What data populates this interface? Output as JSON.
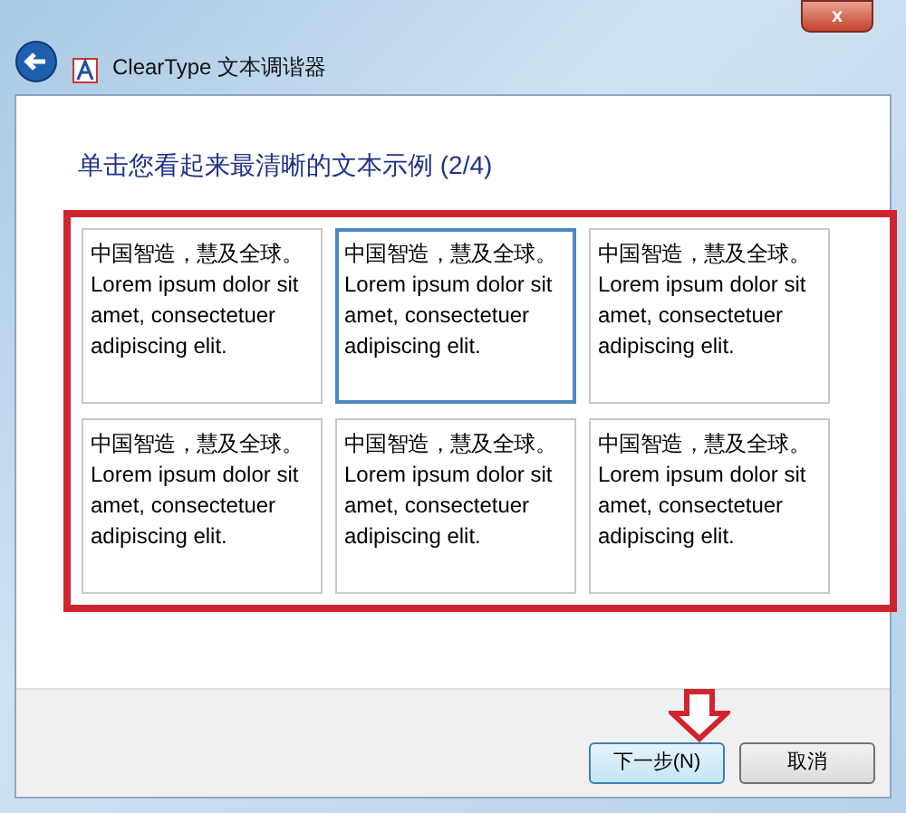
{
  "window": {
    "title": "ClearType 文本调谐器",
    "close": "x"
  },
  "heading": "单击您看起来最清晰的文本示例 (2/4)",
  "samples": [
    {
      "chinese": "中国智造，慧及全球。",
      "latin": "Lorem ipsum dolor sit amet, consectetuer adipiscing elit.",
      "selected": false
    },
    {
      "chinese": "中国智造，慧及全球。",
      "latin": "Lorem ipsum dolor sit amet, consectetuer adipiscing elit.",
      "selected": true
    },
    {
      "chinese": "中国智造，慧及全球。",
      "latin": "Lorem ipsum dolor sit amet, consectetuer adipiscing elit.",
      "selected": false
    },
    {
      "chinese": "中国智造，慧及全球。",
      "latin": "Lorem ipsum dolor sit amet, consectetuer adipiscing elit.",
      "selected": false
    },
    {
      "chinese": "中国智造，慧及全球。",
      "latin": "Lorem ipsum dolor sit amet, consectetuer adipiscing elit.",
      "selected": false
    },
    {
      "chinese": "中国智造，慧及全球。",
      "latin": "Lorem ipsum dolor sit amet, consectetuer adipiscing elit.",
      "selected": false
    }
  ],
  "buttons": [
    {
      "label": "下一步(N)",
      "default": true
    },
    {
      "label": "取消",
      "default": false
    }
  ]
}
